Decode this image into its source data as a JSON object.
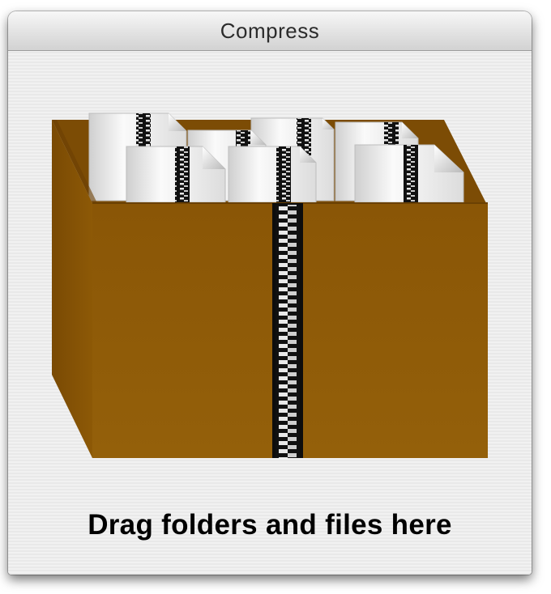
{
  "window": {
    "title": "Compress"
  },
  "drop_zone": {
    "label": "Drag folders and files here",
    "icon": "zipped-box-of-files-icon",
    "box_color": "#8f5a07"
  }
}
